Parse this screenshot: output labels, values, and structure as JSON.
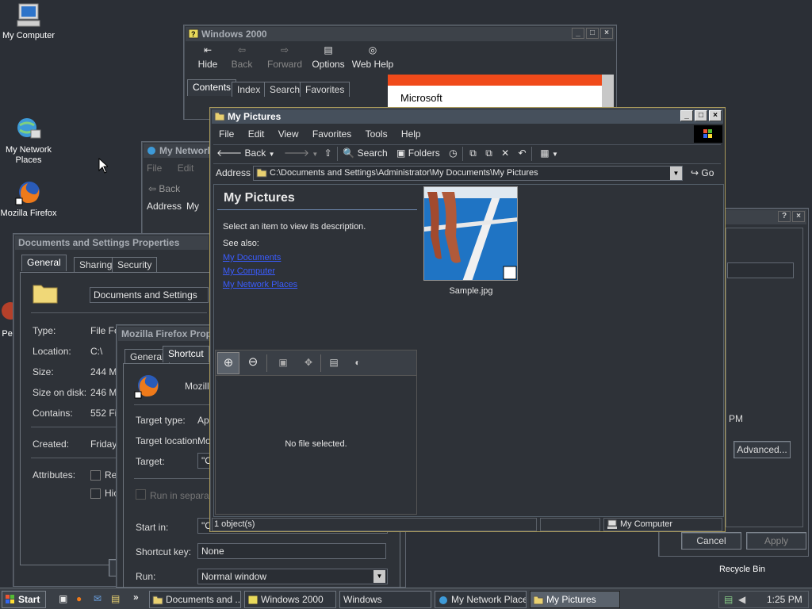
{
  "desktop": {
    "icons": [
      {
        "label": "My Computer",
        "icon": "my-computer-icon"
      },
      {
        "label": "My Network Places",
        "icon": "network-places-icon"
      },
      {
        "label": "Mozilla Firefox",
        "icon": "firefox-icon"
      },
      {
        "label": "Peg",
        "icon": "shortcut-icon"
      },
      {
        "label": "Recycle Bin",
        "icon": "recycle-bin-icon"
      }
    ]
  },
  "win2000": {
    "title": "Windows 2000",
    "toolbar": [
      "Hide",
      "Back",
      "Forward",
      "Options",
      "Web Help"
    ],
    "tabs": [
      "Contents",
      "Index",
      "Search",
      "Favorites"
    ],
    "banner": "Microsoft"
  },
  "mynet": {
    "title": "My Network",
    "menu": [
      "File",
      "Edit"
    ],
    "back": "Back",
    "address_label": "Address",
    "address_value": "My"
  },
  "docprops": {
    "title": "Documents and Settings Properties",
    "tabs": [
      "General",
      "Sharing",
      "Security"
    ],
    "name": "Documents and Settings",
    "labels": [
      "Type:",
      "Location:",
      "Size:",
      "Size on disk:",
      "Contains:",
      "Created:",
      "Attributes:"
    ],
    "values": [
      "File Fo",
      "C:\\",
      "244 MI",
      "246 MI",
      "552 Fil",
      "Friday,"
    ],
    "attr1": "Re",
    "attr2": "Hic"
  },
  "ffprops": {
    "title": "Mozilla Firefox Prope",
    "tabs": [
      "General",
      "Shortcut"
    ],
    "name": "Mozill",
    "labels": [
      "Target type:",
      "Target location:",
      "Target:"
    ],
    "values": [
      "Ap",
      "Mo",
      "\"C"
    ],
    "run_separate": "Run in separate",
    "startin_label": "Start in:",
    "startin_value": "\"C",
    "shortcut_label": "Shortcut key:",
    "shortcut_value": "None",
    "run_label": "Run:",
    "run_value": "Normal window"
  },
  "bgdialog": {
    "time_text": "PM",
    "advanced": "Advanced...",
    "cancel": "Cancel",
    "apply": "Apply"
  },
  "mypics": {
    "title": "My Pictures",
    "menu": [
      "File",
      "Edit",
      "View",
      "Favorites",
      "Tools",
      "Help"
    ],
    "toolbar": {
      "back": "Back",
      "search": "Search",
      "folders": "Folders"
    },
    "address_label": "Address",
    "address_value": "C:\\Documents and Settings\\Administrator\\My Documents\\My Pictures",
    "go": "Go",
    "panel_title": "My Pictures",
    "panel_desc": "Select an item to view its description.",
    "see_also": "See also:",
    "links": [
      "My Documents",
      "My Computer",
      "My Network Places"
    ],
    "preview_empty": "No file selected.",
    "file_name": "Sample.jpg",
    "status_left": "1 object(s)",
    "status_right": "My Computer"
  },
  "taskbar": {
    "start": "Start",
    "chevron": "»",
    "items": [
      "Documents and ...",
      "Windows 2000",
      "Windows",
      "My Network Places",
      "My Pictures"
    ],
    "clock": "1:25 PM"
  }
}
